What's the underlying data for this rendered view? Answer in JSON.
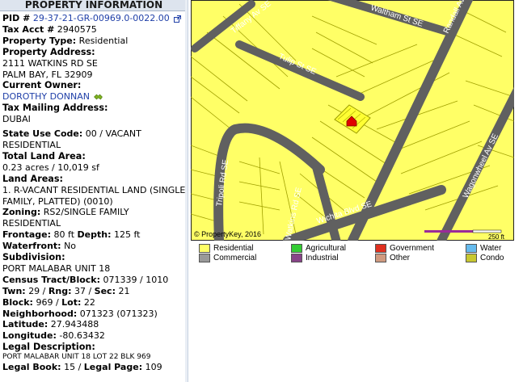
{
  "panel": {
    "title": "PROPERTY INFORMATION"
  },
  "fields": {
    "pid_label": "PID #",
    "pid_value": "29-37-21-GR-00969.0-0022.00",
    "tax_acct_label": "Tax Acct #",
    "tax_acct_value": "2940575",
    "property_type_label": "Property Type:",
    "property_type_value": "Residential",
    "address_label": "Property Address:",
    "address_line1": "2111 WATKINS RD SE",
    "address_line2": "PALM BAY, FL 32909",
    "owner_label": "Current Owner:",
    "owner_value": "DOROTHY DONNAN",
    "mailing_label": "Tax Mailing Address:",
    "mailing_value": "DUBAI",
    "state_use_label": "State Use Code:",
    "state_use_value": "00 / VACANT",
    "state_use_value2": "RESIDENTIAL",
    "total_land_label": "Total Land Area:",
    "total_land_value": "0.23 acres / 10,019 sf",
    "land_areas_label": "Land Areas:",
    "land_areas_line1": "1. R-VACANT RESIDENTIAL LAND (SINGLE",
    "land_areas_line2": "FAMILY, PLATTED) (0010)",
    "zoning_label": "Zoning:",
    "zoning_value": "RS2/SINGLE FAMILY",
    "zoning_value2": "RESIDENTIAL",
    "frontage_label": "Frontage:",
    "frontage_value": "80 ft",
    "depth_label": "Depth:",
    "depth_value": "125 ft",
    "waterfront_label": "Waterfront:",
    "waterfront_value": "No",
    "subdivision_label": "Subdivision:",
    "subdivision_value": "PORT MALABAR UNIT 18",
    "census_label": "Census Tract/Block:",
    "census_value": "071339 / 1010",
    "twn_label": "Twn:",
    "twn_value": "29",
    "rng_label": "Rng:",
    "rng_value": "37",
    "sec_label": "Sec:",
    "sec_value": "21",
    "block_label": "Block:",
    "block_value": "969",
    "lot_label": "Lot:",
    "lot_value": "22",
    "neighborhood_label": "Neighborhood:",
    "neighborhood_value": "071323 (071323)",
    "latitude_label": "Latitude:",
    "latitude_value": "27.943488",
    "longitude_label": "Longitude:",
    "longitude_value": "-80.63432",
    "legal_desc_label": "Legal Description:",
    "legal_desc_value": "PORT MALABAR UNIT 18 LOT 22 BLK 969",
    "legal_book_label": "Legal Book:",
    "legal_book_value": "15",
    "legal_page_label": "Legal Page:",
    "legal_page_value": "109"
  },
  "map": {
    "copyright": "© PropertyKey, 2016",
    "scale_label": "250 ft",
    "streets": {
      "tiffany": "Tiffany Av SE",
      "waltham": "Waltham St SE",
      "randall": "Randall Av SE",
      "tulip": "Tulip St SE",
      "wagonwheel": "Wagonwheel Av SE",
      "tripoli": "Tripoli Rd SE",
      "watkins": "Watkins Rd SE",
      "wichita": "Wichita Blvd SE"
    },
    "colors": {
      "parcel": "#ffff66",
      "road": "#606060",
      "lines": "#a0a000",
      "marker": "#e00000"
    }
  },
  "legend": [
    {
      "label": "Residential",
      "color": "#ffff66"
    },
    {
      "label": "Agricultural",
      "color": "#33cc33"
    },
    {
      "label": "Government",
      "color": "#e03020"
    },
    {
      "label": "Water",
      "color": "#66bbee"
    },
    {
      "label": "Commercial",
      "color": "#999999"
    },
    {
      "label": "Industrial",
      "color": "#884488"
    },
    {
      "label": "Other",
      "color": "#d09a80"
    },
    {
      "label": "Condo",
      "color": "#c8c830"
    }
  ]
}
